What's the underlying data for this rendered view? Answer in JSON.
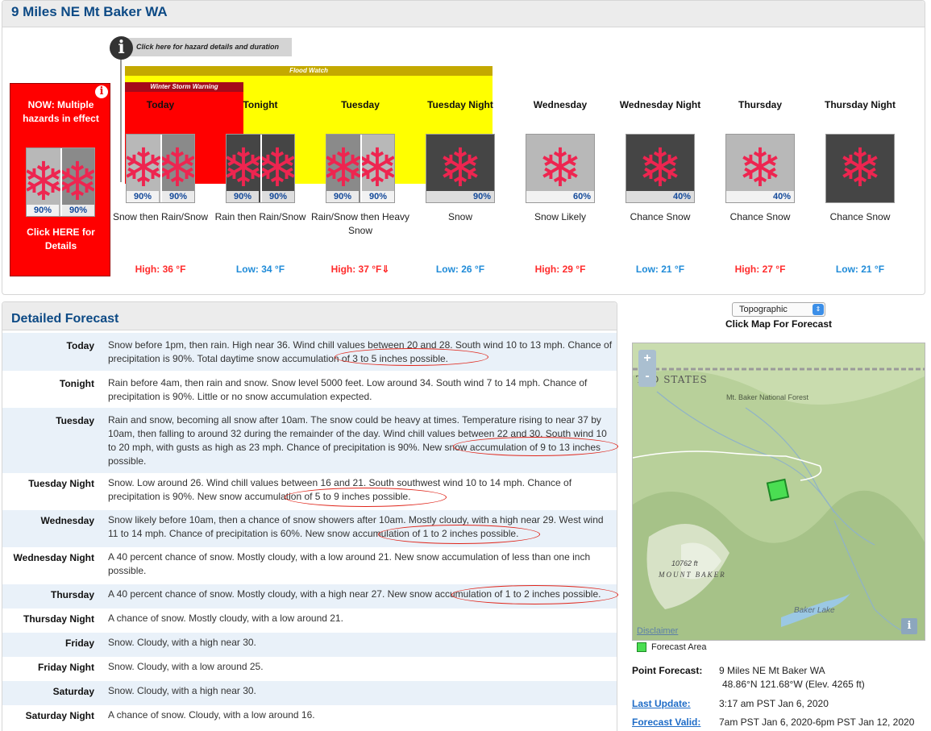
{
  "location": {
    "title": "9 Miles NE Mt Baker WA"
  },
  "hazard": {
    "link_label": "Click here for hazard details and duration",
    "now_title": "NOW: Multiple hazards in effect",
    "now_details": "Click HERE for Details",
    "now_pop_left": "90%",
    "now_pop_right": "90%",
    "flood_watch": "Flood Watch",
    "winter_storm_warning": "Winter Storm Warning"
  },
  "periods": [
    {
      "name": "Today",
      "desc": "Snow then Rain/Snow",
      "temp": "High: 36 °F",
      "temp_kind": "high",
      "pop_left": "90%",
      "pop_right": "90%",
      "icon": "snow-then-rain-snow-icon"
    },
    {
      "name": "Tonight",
      "desc": "Rain then Rain/Snow",
      "temp": "Low: 34 °F",
      "temp_kind": "low",
      "pop_left": "90%",
      "pop_right": "90%",
      "icon": "rain-then-rain-snow-icon"
    },
    {
      "name": "Tuesday",
      "desc": "Rain/Snow then Heavy Snow",
      "temp": "High: 37 °F⇓",
      "temp_kind": "high",
      "pop_left": "90%",
      "pop_right": "90%",
      "icon": "rain-snow-then-heavy-snow-icon"
    },
    {
      "name": "Tuesday Night",
      "desc": "Snow",
      "temp": "Low: 26 °F",
      "temp_kind": "low",
      "pop": "90%",
      "icon": "snow-icon"
    },
    {
      "name": "Wednesday",
      "desc": "Snow Likely",
      "temp": "High: 29 °F",
      "temp_kind": "high",
      "pop": "60%",
      "icon": "snow-likely-icon"
    },
    {
      "name": "Wednesday Night",
      "desc": "Chance Snow",
      "temp": "Low: 21 °F",
      "temp_kind": "low",
      "pop": "40%",
      "icon": "chance-snow-icon"
    },
    {
      "name": "Thursday",
      "desc": "Chance Snow",
      "temp": "High: 27 °F",
      "temp_kind": "high",
      "pop": "40%",
      "icon": "chance-snow-icon"
    },
    {
      "name": "Thursday Night",
      "desc": "Chance Snow",
      "temp": "Low: 21 °F",
      "temp_kind": "low",
      "pop": "",
      "icon": "chance-snow-icon"
    }
  ],
  "detailed": {
    "title": "Detailed Forecast",
    "rows": [
      {
        "label": "Today",
        "text": "Snow before 1pm, then rain. High near 36. Wind chill values between 20 and 28. South wind 10 to 13 mph. Chance of precipitation is 90%. Total daytime snow accumulation of 3 to 5 inches possible."
      },
      {
        "label": "Tonight",
        "text": "Rain before 4am, then rain and snow. Snow level 5000 feet. Low around 34. South wind 7 to 14 mph. Chance of precipitation is 90%. Little or no snow accumulation expected."
      },
      {
        "label": "Tuesday",
        "text": "Rain and snow, becoming all snow after 10am. The snow could be heavy at times. Temperature rising to near 37 by 10am, then falling to around 32 during the remainder of the day. Wind chill values between 22 and 30. South wind 10 to 20 mph, with gusts as high as 23 mph. Chance of precipitation is 90%. New snow accumulation of 9 to 13 inches possible."
      },
      {
        "label": "Tuesday Night",
        "text": "Snow. Low around 26. Wind chill values between 16 and 21. South southwest wind 10 to 14 mph. Chance of precipitation is 90%. New snow accumulation of 5 to 9 inches possible."
      },
      {
        "label": "Wednesday",
        "text": "Snow likely before 10am, then a chance of snow showers after 10am. Mostly cloudy, with a high near 29. West wind 11 to 14 mph. Chance of precipitation is 60%. New snow accumulation of 1 to 2 inches possible."
      },
      {
        "label": "Wednesday Night",
        "text": "A 40 percent chance of snow. Mostly cloudy, with a low around 21. New snow accumulation of less than one inch possible."
      },
      {
        "label": "Thursday",
        "text": "A 40 percent chance of snow. Mostly cloudy, with a high near 27. New snow accumulation of 1 to 2 inches possible."
      },
      {
        "label": "Thursday Night",
        "text": "A chance of snow. Mostly cloudy, with a low around 21."
      },
      {
        "label": "Friday",
        "text": "Snow. Cloudy, with a high near 30."
      },
      {
        "label": "Friday Night",
        "text": "Snow. Cloudy, with a low around 25."
      },
      {
        "label": "Saturday",
        "text": "Snow. Cloudy, with a high near 30."
      },
      {
        "label": "Saturday Night",
        "text": "A chance of snow. Cloudy, with a low around 16."
      }
    ]
  },
  "map": {
    "layer_select": "Topographic",
    "caption": "Click Map For Forecast",
    "label_states": "TED STATES",
    "label_forest": "Mt. Baker National Forest",
    "label_peak_elev": "10762 ft",
    "label_peak_name": "MOUNT BAKER",
    "label_lake": "Baker Lake",
    "disclaimer": "Disclaimer",
    "zoom_in": "+",
    "zoom_out": "-",
    "legend": "Forecast Area"
  },
  "point_forecast": {
    "label": "Point Forecast:",
    "location": "9 Miles NE Mt Baker WA",
    "coords": "48.86°N 121.68°W (Elev. 4265 ft)",
    "last_update_label": "Last Update",
    "last_update": "3:17 am PST Jan 6, 2020",
    "valid_label": "Forecast Valid",
    "valid": "7am PST Jan 6, 2020-6pm PST Jan 12, 2020"
  },
  "colors": {
    "title_blue": "#0d4a85",
    "high_red": "#ff2b2b",
    "low_blue": "#1f8bd8",
    "flood_yellow": "#ffff00",
    "warning_red": "#ff0000",
    "link_blue": "#1e6cc7"
  }
}
